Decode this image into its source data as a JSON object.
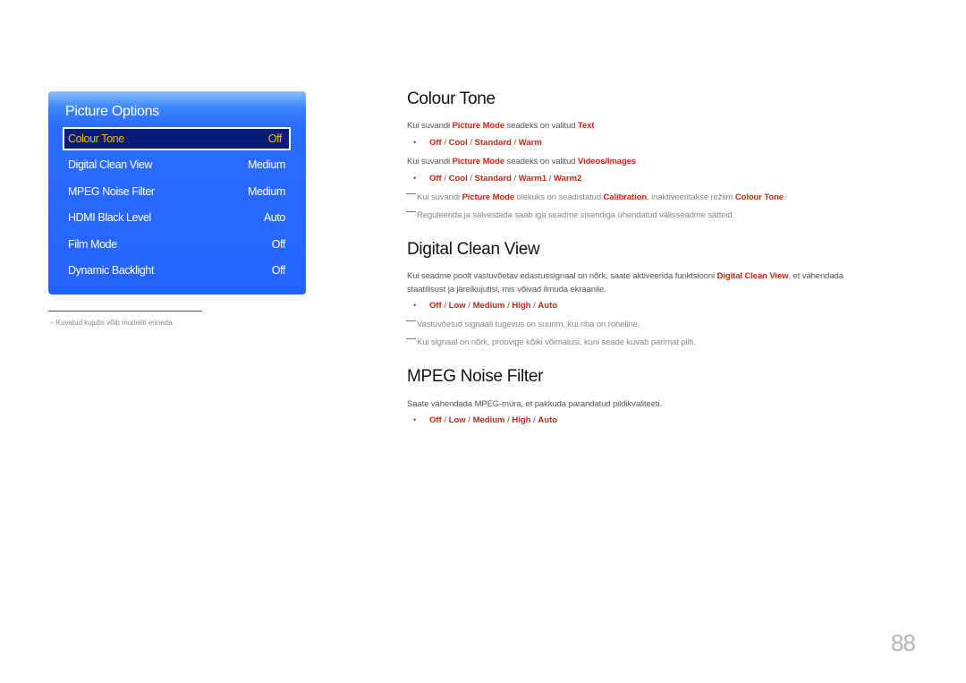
{
  "panel": {
    "title": "Picture Options",
    "items": [
      {
        "label": "Colour Tone",
        "value": "Off",
        "selected": true
      },
      {
        "label": "Digital Clean View",
        "value": "Medium"
      },
      {
        "label": "MPEG Noise Filter",
        "value": "Medium"
      },
      {
        "label": "HDMI Black Level",
        "value": "Auto"
      },
      {
        "label": "Film Mode",
        "value": "Off"
      },
      {
        "label": "Dynamic Backlight",
        "value": "Off"
      }
    ],
    "footnote": "–  Kuvatud kujutis võib mudeliti erineda."
  },
  "colour_tone": {
    "heading": "Colour Tone",
    "line1": {
      "pre": "Kui suvandi ",
      "k1": "Picture Mode",
      "mid": " seadeks on valitud ",
      "k2": "Text"
    },
    "options1": [
      "Off",
      "Cool",
      "Standard",
      "Warm"
    ],
    "line2": {
      "pre": "Kui suvandi ",
      "k1": "Picture Mode",
      "mid": " seadeks on valitud ",
      "k2": "Videos/Images"
    },
    "options2": [
      "Off",
      "Cool",
      "Standard",
      "Warm1",
      "Warm2"
    ],
    "note1": {
      "pre": "Kui suvandi ",
      "k1": "Picture Mode",
      "mid": " olekuks on seadistatud ",
      "k2": "Calibration",
      "mid2": ", inaktiveeritakse režiim ",
      "k3": "Colour Tone",
      "post": "."
    },
    "note2": "Reguleerida ja salvestada saab iga seadme sisendiga ühendatud välisseadme sätteid."
  },
  "digital_clean_view": {
    "heading": "Digital Clean View",
    "desc": {
      "pre": "Kui seadme poolt vastuvõetav edastussignaal on nõrk, saate aktiveerida funktsiooni ",
      "k1": "Digital Clean View",
      "post": ", et vähendada",
      "line2": "staatilisust ja järelkujutisi, mis võivad ilmuda ekraanile."
    },
    "options": [
      "Off",
      "Low",
      "Medium",
      "High",
      "Auto"
    ],
    "note1": "Vastuvõetud signaali tugevus on suurim, kui riba on roheline.",
    "note2": "Kui signaal on nõrk, proovige kõiki võimalusi, kuni seade kuvab parimat pilti."
  },
  "mpeg_noise_filter": {
    "heading": "MPEG Noise Filter",
    "desc": "Saate vähendada MPEG-müra, et pakkuda parandatud pildikvaliteeti.",
    "options": [
      "Off",
      "Low",
      "Medium",
      "High",
      "Auto"
    ]
  },
  "page_number": "88",
  "colors": {
    "accent": "#c8280f",
    "panel_blue": "#2563ff",
    "selected_bg": "#0a1c7a",
    "selected_text": "#f2b900"
  },
  "separator": " / ",
  "bullet": "•"
}
